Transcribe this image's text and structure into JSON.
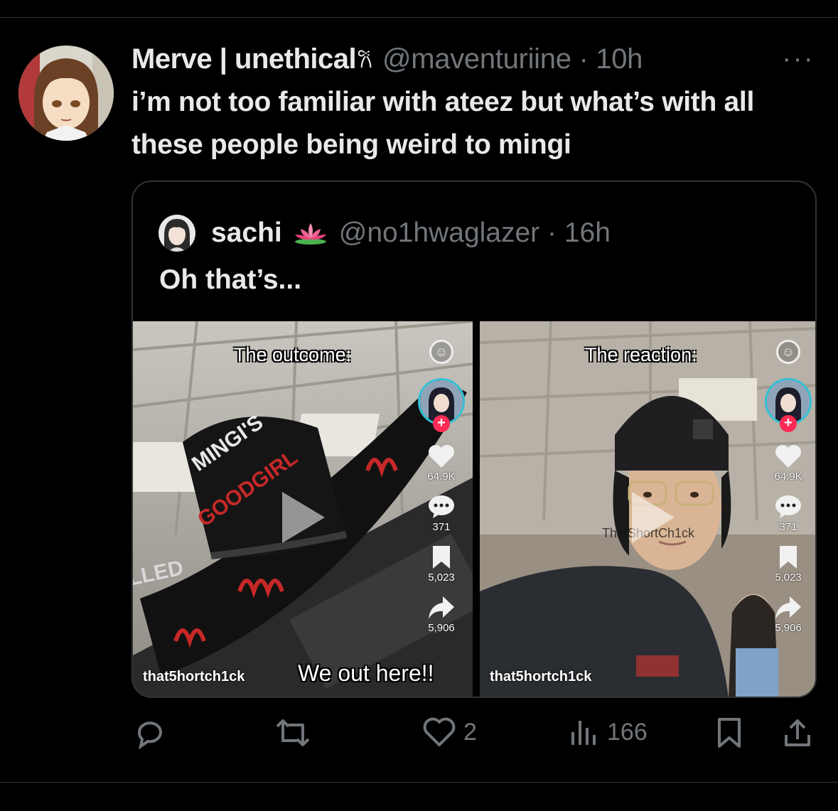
{
  "tweet": {
    "author_name": "Merve | unethical",
    "author_name_suffix": "𐙚",
    "handle_time": "@maventuriine · 10h",
    "more_label": "···",
    "text": "i’m not too familiar with ateez but what’s with all these people being weird to mingi"
  },
  "quote": {
    "author_name": "sachi",
    "emoji_icon": "lotus-icon",
    "handle_time": "@no1hwaglazer · 16h",
    "text": "Oh that’s..."
  },
  "media": {
    "left": {
      "caption": "The outcome:",
      "watermark": "that5hortch1ck",
      "bottom_caption": "We out here!!",
      "likes": "64.9K",
      "comments": "371",
      "saves": "5,023",
      "shares": "5,906",
      "hat_text_top": "MINGI'S",
      "hat_text_bottom": "GOODGIRL",
      "sign_text": "LLED"
    },
    "right": {
      "caption": "The reaction:",
      "watermark": "that5hortch1ck",
      "ghost_text": "ThatShortCh1ck",
      "likes": "64.9K",
      "comments": "371",
      "saves": "5,023",
      "shares": "5,906"
    }
  },
  "actions": {
    "likes": "2",
    "views": "166"
  },
  "colors": {
    "background": "#000000",
    "text_primary": "#e7e9ea",
    "text_secondary": "#71767b",
    "border": "#2f3336",
    "tiktok_red": "#fe2c55"
  }
}
